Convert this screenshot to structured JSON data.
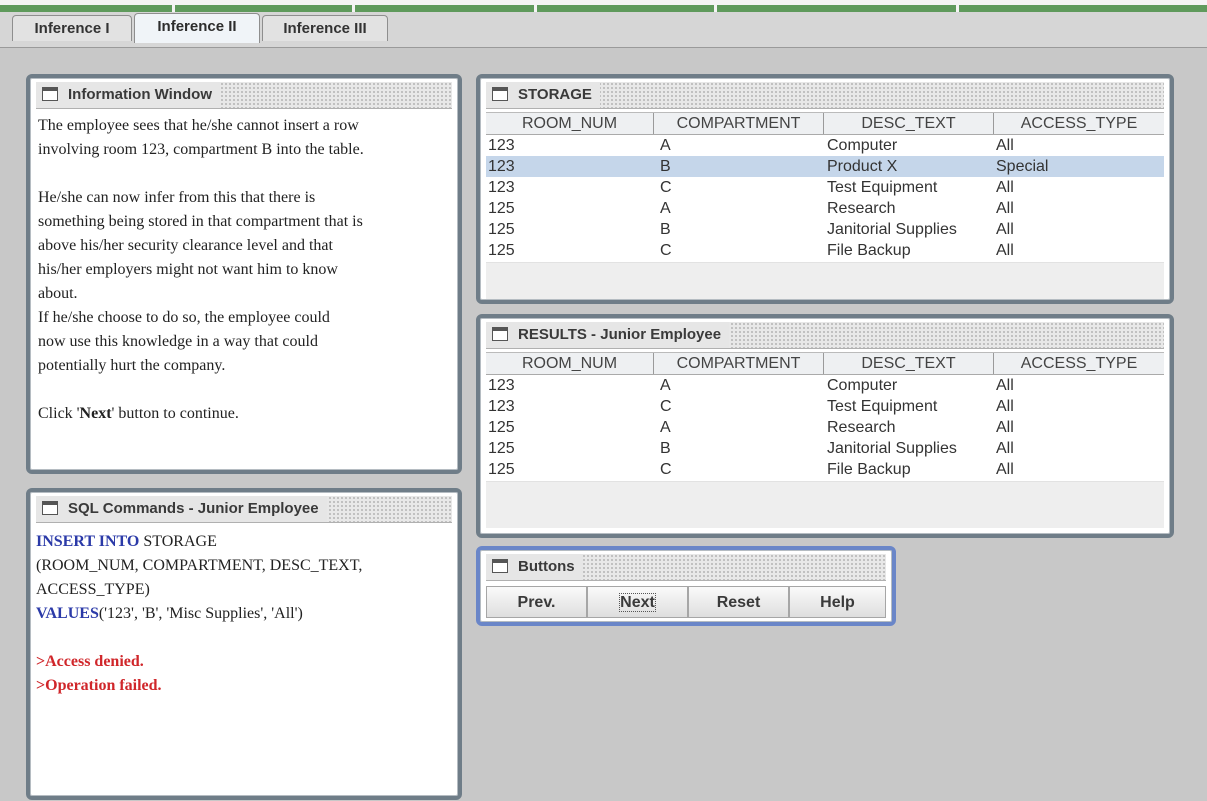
{
  "tabs": [
    {
      "label": "Inference I"
    },
    {
      "label": "Inference II",
      "active": true
    },
    {
      "label": "Inference III"
    }
  ],
  "info_window": {
    "title": "Information Window",
    "lines": [
      "The employee sees that he/she cannot insert a row",
      "involving room 123, compartment B into the table.",
      "",
      "He/she can now infer from this that there is",
      "something being stored in that compartment that is",
      "above his/her security clearance level and that",
      "his/her employers might not want him to know",
      "about.",
      "If he/she choose to do so, the employee could",
      "now use this knowledge in a way that could",
      "potentially hurt the company.",
      ""
    ],
    "click_prefix": "Click '",
    "click_bold": "Next",
    "click_suffix": "' button to continue."
  },
  "sql_window": {
    "title": "SQL Commands - Junior Employee",
    "insert_kw": "INSERT INTO",
    "insert_rest": " STORAGE",
    "columns_line1": "(ROOM_NUM, COMPARTMENT, DESC_TEXT,",
    "columns_line2": "ACCESS_TYPE)",
    "values_kw": "VALUES",
    "values_rest": "('123', 'B', 'Misc Supplies', 'All')",
    "error1": ">Access denied.",
    "error2": ">Operation failed."
  },
  "storage_table": {
    "title": "STORAGE",
    "columns": [
      "ROOM_NUM",
      "COMPARTMENT",
      "DESC_TEXT",
      "ACCESS_TYPE"
    ],
    "rows": [
      [
        "123",
        "A",
        "Computer",
        "All"
      ],
      [
        "123",
        "B",
        "Product X",
        "Special"
      ],
      [
        "123",
        "C",
        "Test Equipment",
        "All"
      ],
      [
        "125",
        "A",
        "Research",
        "All"
      ],
      [
        "125",
        "B",
        "Janitorial Supplies",
        "All"
      ],
      [
        "125",
        "C",
        "File Backup",
        "All"
      ]
    ],
    "selected_row": 1
  },
  "results_table": {
    "title": "RESULTS - Junior Employee",
    "columns": [
      "ROOM_NUM",
      "COMPARTMENT",
      "DESC_TEXT",
      "ACCESS_TYPE"
    ],
    "rows": [
      [
        "123",
        "A",
        "Computer",
        "All"
      ],
      [
        "123",
        "C",
        "Test Equipment",
        "All"
      ],
      [
        "125",
        "A",
        "Research",
        "All"
      ],
      [
        "125",
        "B",
        "Janitorial Supplies",
        "All"
      ],
      [
        "125",
        "C",
        "File Backup",
        "All"
      ]
    ]
  },
  "buttons_panel": {
    "title": "Buttons",
    "prev": "Prev.",
    "next": "Next",
    "reset": "Reset",
    "help": "Help"
  },
  "colors": {
    "top_accent": "#5f9a5c",
    "panel_border": "#6f7d88",
    "focused_panel_border": "#6a86c8",
    "selected_row": "#c5d6ea",
    "sql_keyword": "#2b3aa8",
    "error_text": "#d0262a"
  }
}
